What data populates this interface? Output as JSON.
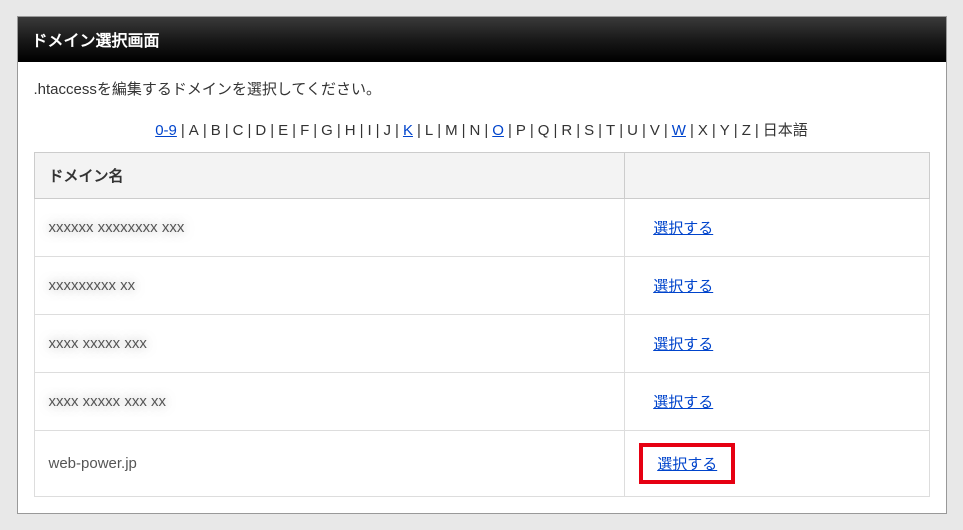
{
  "header": {
    "title": "ドメイン選択画面"
  },
  "instruction": ".htaccessを編集するドメインを選択してください。",
  "index_nav": {
    "items": [
      {
        "label": "0-9",
        "link": true
      },
      {
        "label": "A",
        "link": false
      },
      {
        "label": "B",
        "link": false
      },
      {
        "label": "C",
        "link": false
      },
      {
        "label": "D",
        "link": false
      },
      {
        "label": "E",
        "link": false
      },
      {
        "label": "F",
        "link": false
      },
      {
        "label": "G",
        "link": false
      },
      {
        "label": "H",
        "link": false
      },
      {
        "label": "I",
        "link": false
      },
      {
        "label": "J",
        "link": false
      },
      {
        "label": "K",
        "link": true
      },
      {
        "label": "L",
        "link": false
      },
      {
        "label": "M",
        "link": false
      },
      {
        "label": "N",
        "link": false
      },
      {
        "label": "O",
        "link": true
      },
      {
        "label": "P",
        "link": false
      },
      {
        "label": "Q",
        "link": false
      },
      {
        "label": "R",
        "link": false
      },
      {
        "label": "S",
        "link": false
      },
      {
        "label": "T",
        "link": false
      },
      {
        "label": "U",
        "link": false
      },
      {
        "label": "V",
        "link": false
      },
      {
        "label": "W",
        "link": true
      },
      {
        "label": "X",
        "link": false
      },
      {
        "label": "Y",
        "link": false
      },
      {
        "label": "Z",
        "link": false
      },
      {
        "label": "日本語",
        "link": false
      }
    ]
  },
  "table": {
    "header_name": "ドメイン名",
    "header_action": "",
    "action_label": "選択する",
    "rows": [
      {
        "name": "xxxxxx xxxxxxxx xxx",
        "blurred": true,
        "highlight": false
      },
      {
        "name": "xxxxxxxxx xx",
        "blurred": true,
        "highlight": false
      },
      {
        "name": "xxxx xxxxx xxx",
        "blurred": true,
        "highlight": false
      },
      {
        "name": "xxxx xxxxx xxx xx",
        "blurred": true,
        "highlight": false
      },
      {
        "name": "web-power.jp",
        "blurred": false,
        "highlight": true
      }
    ]
  }
}
